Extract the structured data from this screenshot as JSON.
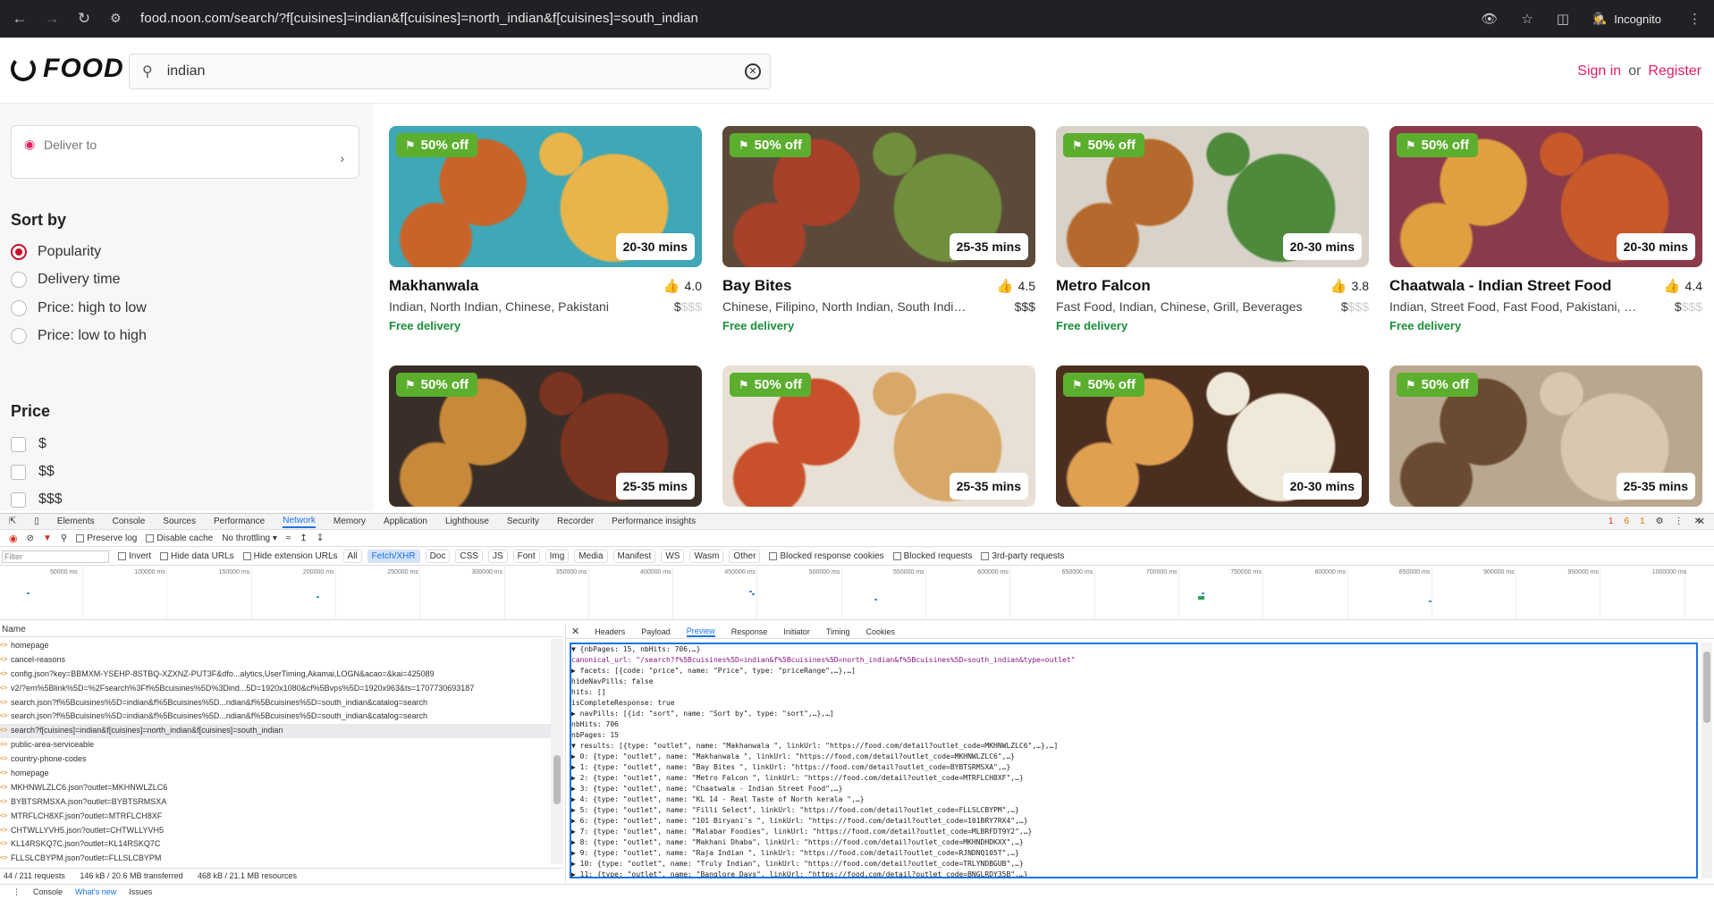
{
  "browser": {
    "url": "food.noon.com/search/?f[cuisines]=indian&f[cuisines]=north_indian&f[cuisines]=south_indian",
    "profile_label": "Incognito"
  },
  "header": {
    "logo_text": "FOOD",
    "search_value": "indian",
    "sign_in": "Sign in",
    "or": "or",
    "register": "Register"
  },
  "sidebar": {
    "deliver_to": "Deliver to",
    "sort_title": "Sort by",
    "sort_options": [
      "Popularity",
      "Delivery time",
      "Price: high to low",
      "Price: low to high"
    ],
    "selected_sort": "Popularity",
    "price_title": "Price",
    "price_options": [
      "$",
      "$$",
      "$$$"
    ]
  },
  "restaurants": [
    {
      "discount": "50% off",
      "eta": "20-30 mins",
      "name": "Makhanwala",
      "rating": "4.0",
      "cuisines": "Indian, North Indian, Chinese, Pakistani",
      "price_on": "$",
      "price_off": "$$$",
      "delivery": "Free delivery",
      "colors": [
        "#3fa7b5",
        "#c8642a",
        "#e9b54a"
      ]
    },
    {
      "discount": "50% off",
      "eta": "25-35 mins",
      "name": "Bay Bites",
      "rating": "4.5",
      "cuisines": "Chinese, Filipino, North Indian, South Indian, Se...",
      "price_on": "$$$",
      "price_off": "",
      "delivery": "Free delivery",
      "colors": [
        "#5b4a3a",
        "#a8402a",
        "#6f8f3c"
      ]
    },
    {
      "discount": "50% off",
      "eta": "20-30 mins",
      "name": "Metro Falcon",
      "rating": "3.8",
      "cuisines": "Fast Food, Indian, Chinese, Grill, Beverages",
      "price_on": "$",
      "price_off": "$$$",
      "delivery": "Free delivery",
      "colors": [
        "#d9d2c8",
        "#b46a2c",
        "#4d8a3c"
      ]
    },
    {
      "discount": "50% off",
      "eta": "20-30 mins",
      "name": "Chaatwala - Indian Street Food",
      "rating": "4.4",
      "cuisines": "Indian, Street Food, Fast Food, Pakistani, North ...",
      "price_on": "$",
      "price_off": "$$$",
      "delivery": "Free delivery",
      "colors": [
        "#8a3a4a",
        "#e0a040",
        "#c85a2a"
      ]
    },
    {
      "discount": "50% off",
      "eta": "25-35 mins",
      "name": "",
      "rating": "",
      "cuisines": "",
      "price_on": "",
      "price_off": "",
      "delivery": "",
      "colors": [
        "#3a2e28",
        "#c88a3a",
        "#7a3420"
      ]
    },
    {
      "discount": "50% off",
      "eta": "25-35 mins",
      "name": "",
      "rating": "",
      "cuisines": "",
      "price_on": "",
      "price_off": "",
      "delivery": "",
      "colors": [
        "#e8e0d4",
        "#c8502a",
        "#d8a868"
      ]
    },
    {
      "discount": "50% off",
      "eta": "20-30 mins",
      "name": "",
      "rating": "",
      "cuisines": "",
      "price_on": "",
      "price_off": "",
      "delivery": "",
      "colors": [
        "#4a2e20",
        "#e0a050",
        "#f0e8d8"
      ]
    },
    {
      "discount": "50% off",
      "eta": "25-35 mins",
      "name": "",
      "rating": "",
      "cuisines": "",
      "price_on": "",
      "price_off": "",
      "delivery": "",
      "colors": [
        "#b8a890",
        "#6a4a30",
        "#d8c8b0"
      ]
    }
  ],
  "devtools": {
    "tabs": [
      "Elements",
      "Console",
      "Sources",
      "Performance",
      "Network",
      "Memory",
      "Application",
      "Lighthouse",
      "Security",
      "Recorder",
      "Performance insights"
    ],
    "active_tab": "Network",
    "status": {
      "errors": "1",
      "warnings": "6",
      "issues": "1"
    },
    "toolbar": {
      "preserve_log": "Preserve log",
      "disable_cache": "Disable cache",
      "throttle": "No throttling"
    },
    "filter_placeholder": "Filter",
    "filter_options": [
      "Invert",
      "Hide data URLs",
      "Hide extension URLs"
    ],
    "type_filters": [
      "All",
      "Fetch/XHR",
      "Doc",
      "CSS",
      "JS",
      "Font",
      "Img",
      "Media",
      "Manifest",
      "WS",
      "Wasm",
      "Other"
    ],
    "active_type_filter": "Fetch/XHR",
    "extra_filters": [
      "Blocked response cookies",
      "Blocked requests",
      "3rd-party requests"
    ],
    "timeline_ticks": [
      "50000 ms",
      "100000 ms",
      "150000 ms",
      "200000 ms",
      "250000 ms",
      "300000 ms",
      "350000 ms",
      "400000 ms",
      "450000 ms",
      "500000 ms",
      "550000 ms",
      "600000 ms",
      "650000 ms",
      "700000 ms",
      "750000 ms",
      "800000 ms",
      "850000 ms",
      "900000 ms",
      "950000 ms",
      "1000000 ms"
    ],
    "name_header": "Name",
    "requests": [
      "homepage",
      "cancel-reasons",
      "config.json?key=BBMXM-YSEHP-8STBQ-XZXNZ-PUT3F&dfo...alytics,UserTiming,Akamai,LOGN&acao=&kai=425089",
      "v2/?em%5Blink%5D=%2Fsearch%3Ff%5Bcuisines%5D%3Dind...5D=1920x1080&cf%5Bvps%5D=1920x963&ts=1707730693187",
      "search.json?f%5Bcuisines%5D=indian&f%5Bcuisines%5D...ndian&f%5Bcuisines%5D=south_indian&catalog=search",
      "search.json?f%5Bcuisines%5D=indian&f%5Bcuisines%5D...ndian&f%5Bcuisines%5D=south_indian&catalog=search",
      "search?f[cuisines]=indian&f[cuisines]=north_indian&f[cuisines]=south_indian",
      "public-area-serviceable",
      "country-phone-codes",
      "homepage",
      "MKHNWLZLC6.json?outlet=MKHNWLZLC6",
      "BYBTSRMSXA.json?outlet=BYBTSRMSXA",
      "MTRFLCH8XF.json?outlet=MTRFLCH8XF",
      "CHTWLLYVH5.json?outlet=CHTWLLYVH5",
      "KL14RSKQ7C.json?outlet=KL14RSKQ7C",
      "FLLSLCBYPM.json?outlet=FLLSLCBYPM"
    ],
    "selected_request_index": 6,
    "summary": {
      "requests": "44 / 211 requests",
      "transferred": "146 kB / 20.6 MB transferred",
      "resources": "468 kB / 21.1 MB resources"
    },
    "detail_tabs": [
      "Headers",
      "Payload",
      "Preview",
      "Response",
      "Initiator",
      "Timing",
      "Cookies"
    ],
    "active_detail_tab": "Preview",
    "preview_lines": [
      "▼ {nbPages: 15, nbHits: 706,…}",
      "    canonical_url: \"/search?f%5Bcuisines%5D=indian&f%5Bcuisines%5D=north_indian&f%5Bcuisines%5D=south_indian&type=outlet\"",
      "  ▶ facets: [{code: \"price\", name: \"Price\", type: \"priceRange\",…},…]",
      "    hideNavPills: false",
      "    hits: []",
      "    isCompleteResponse: true",
      "  ▶ navPills: [{id: \"sort\", name: \"Sort by\", type: \"sort\",…},…]",
      "    nbHits: 706",
      "    nbPages: 15",
      "  ▼ results: [{type: \"outlet\", name: \"Makhanwala \", linkUrl: \"https://food.com/detail?outlet_code=MKHNWLZLC6\",…},…]",
      "    ▶ 0: {type: \"outlet\", name: \"Makhanwala \", linkUrl: \"https://food.com/detail?outlet_code=MKHNWLZLC6\",…}",
      "    ▶ 1: {type: \"outlet\", name: \"Bay Bites \", linkUrl: \"https://food.com/detail?outlet_code=BYBTSRMSXA\",…}",
      "    ▶ 2: {type: \"outlet\", name: \"Metro Falcon \", linkUrl: \"https://food.com/detail?outlet_code=MTRFLCH8XF\",…}",
      "    ▶ 3: {type: \"outlet\", name: \"Chaatwala - Indian Street Food\",…}",
      "    ▶ 4: {type: \"outlet\", name: \"KL 14 - Real Taste of North kerala \",…}",
      "    ▶ 5: {type: \"outlet\", name: \"Filli Select\", linkUrl: \"https://food.com/detail?outlet_code=FLLSLCBYPM\",…}",
      "    ▶ 6: {type: \"outlet\", name: \"101 Biryani's \", linkUrl: \"https://food.com/detail?outlet_code=101BRY7RX4\",…}",
      "    ▶ 7: {type: \"outlet\", name: \"Malabar Foodies\", linkUrl: \"https://food.com/detail?outlet_code=MLBRFDT9Y2\",…}",
      "    ▶ 8: {type: \"outlet\", name: \"Makhani Dhaba\", linkUrl: \"https://food.com/detail?outlet_code=MKHNDHDKXX\",…}",
      "    ▶ 9: {type: \"outlet\", name: \"Raja Indian \", linkUrl: \"https://food.com/detail?outlet_code=RJNDNQ105T\",…}",
      "    ▶ 10: {type: \"outlet\", name: \"Truly Indian\", linkUrl: \"https://food.com/detail?outlet_code=TRLYNDBGUB\",…}",
      "    ▶ 11: {type: \"outlet\", name: \"Banglore Days\", linkUrl: \"https://food.com/detail?outlet_code=BNGLRDY35B\",…}"
    ],
    "drawer_tabs": [
      "Console",
      "What's new",
      "Issues"
    ],
    "active_drawer_tab": "What's new"
  }
}
